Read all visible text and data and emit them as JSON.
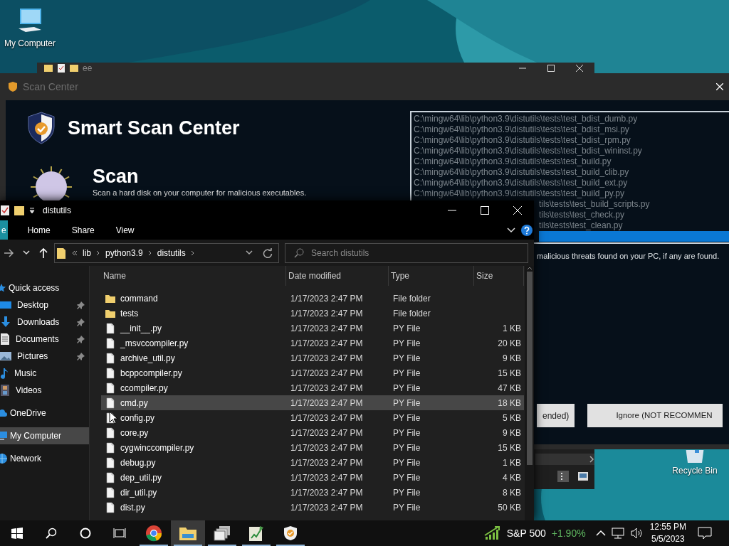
{
  "desktop": {
    "icons": [
      {
        "kind": "computer",
        "label": "My Computer"
      },
      {
        "kind": "recycle",
        "label": "Recycle Bin"
      }
    ]
  },
  "back_window": {
    "title": "ee"
  },
  "scan_window": {
    "title": "Scan Center",
    "heading": "Smart Scan Center",
    "section": {
      "title": "Scan",
      "text": "Scan a hard disk on your computer for malicious executables."
    },
    "results": [
      {
        "path": "C:\\mingw64\\lib\\python3.9\\distutils\\tests\\test_bdist_dumb.py",
        "cut": false,
        "selected": false
      },
      {
        "path": "C:\\mingw64\\lib\\python3.9\\distutils\\tests\\test_bdist_msi.py",
        "cut": false,
        "selected": false
      },
      {
        "path": "C:\\mingw64\\lib\\python3.9\\distutils\\tests\\test_bdist_rpm.py",
        "cut": false,
        "selected": false
      },
      {
        "path": "C:\\mingw64\\lib\\python3.9\\distutils\\tests\\test_bdist_wininst.py",
        "cut": false,
        "selected": false
      },
      {
        "path": "C:\\mingw64\\lib\\python3.9\\distutils\\tests\\test_build.py",
        "cut": false,
        "selected": false
      },
      {
        "path": "C:\\mingw64\\lib\\python3.9\\distutils\\tests\\test_build_clib.py",
        "cut": false,
        "selected": false
      },
      {
        "path": "C:\\mingw64\\lib\\python3.9\\distutils\\tests\\test_build_ext.py",
        "cut": false,
        "selected": false
      },
      {
        "path": "C:\\mingw64\\lib\\python3.9\\distutils\\tests\\test_build_py.py",
        "cut": false,
        "selected": false
      },
      {
        "path": "tils\\tests\\test_build_scripts.py",
        "cut": true,
        "selected": false
      },
      {
        "path": "tils\\tests\\test_check.py",
        "cut": true,
        "selected": false
      },
      {
        "path": "tils\\tests\\test_clean.py",
        "cut": true,
        "selected": false
      },
      {
        "cut": true,
        "selected": true
      }
    ],
    "note": "malicious threats found on your PC, if any are found.",
    "buttons": [
      "ended)",
      "Ignore (NOT RECOMMEN"
    ]
  },
  "explorer": {
    "title": "distutils",
    "ribbon_tabs": [
      {
        "label": "e",
        "kind": "file"
      },
      {
        "label": "Home",
        "kind": "tab"
      },
      {
        "label": "Share",
        "kind": "tab"
      },
      {
        "label": "View",
        "kind": "tab"
      }
    ],
    "path": [
      "lib",
      "python3.9",
      "distutils"
    ],
    "search": {
      "placeholder": "Search distutils"
    },
    "nav": [
      {
        "label": "Quick access",
        "kind": "star",
        "selected": false,
        "children": [
          {
            "label": "Desktop",
            "kind": "desktop",
            "pinned": true,
            "selected": false
          },
          {
            "label": "Downloads",
            "kind": "download",
            "pinned": true,
            "selected": false
          },
          {
            "label": "Documents",
            "kind": "document",
            "pinned": true,
            "selected": false
          },
          {
            "label": "Pictures",
            "kind": "pictures",
            "pinned": true,
            "selected": false
          },
          {
            "label": "Music",
            "kind": "music",
            "pinned": false,
            "selected": false
          },
          {
            "label": "Videos",
            "kind": "video",
            "pinned": false,
            "selected": false
          }
        ]
      },
      {
        "label": "OneDrive",
        "kind": "cloud",
        "selected": false
      },
      {
        "label": "My Computer",
        "kind": "computer",
        "selected": true
      },
      {
        "label": "Network",
        "kind": "network",
        "selected": false
      }
    ],
    "columns": [
      "Name",
      "Date modified",
      "Type",
      "Size"
    ],
    "rows": [
      {
        "kind": "folder",
        "name": "command",
        "date": "1/17/2023 2:47 PM",
        "type": "File folder",
        "size": "",
        "selected": false
      },
      {
        "kind": "folder",
        "name": "tests",
        "date": "1/17/2023 2:47 PM",
        "type": "File folder",
        "size": "",
        "selected": false
      },
      {
        "kind": "file",
        "name": "__init__.py",
        "date": "1/17/2023 2:47 PM",
        "type": "PY File",
        "size": "1 KB",
        "selected": false
      },
      {
        "kind": "file",
        "name": "_msvccompiler.py",
        "date": "1/17/2023 2:47 PM",
        "type": "PY File",
        "size": "20 KB",
        "selected": false
      },
      {
        "kind": "file",
        "name": "archive_util.py",
        "date": "1/17/2023 2:47 PM",
        "type": "PY File",
        "size": "9 KB",
        "selected": false
      },
      {
        "kind": "file",
        "name": "bcppcompiler.py",
        "date": "1/17/2023 2:47 PM",
        "type": "PY File",
        "size": "15 KB",
        "selected": false
      },
      {
        "kind": "file",
        "name": "ccompiler.py",
        "date": "1/17/2023 2:47 PM",
        "type": "PY File",
        "size": "47 KB",
        "selected": false
      },
      {
        "kind": "file",
        "name": "cmd.py",
        "date": "1/17/2023 2:47 PM",
        "type": "PY File",
        "size": "18 KB",
        "selected": true
      },
      {
        "kind": "file",
        "name": "config.py",
        "date": "1/17/2023 2:47 PM",
        "type": "PY File",
        "size": "5 KB",
        "selected": false
      },
      {
        "kind": "file",
        "name": "core.py",
        "date": "1/17/2023 2:47 PM",
        "type": "PY File",
        "size": "9 KB",
        "selected": false
      },
      {
        "kind": "file",
        "name": "cygwinccompiler.py",
        "date": "1/17/2023 2:47 PM",
        "type": "PY File",
        "size": "15 KB",
        "selected": false
      },
      {
        "kind": "file",
        "name": "debug.py",
        "date": "1/17/2023 2:47 PM",
        "type": "PY File",
        "size": "1 KB",
        "selected": false
      },
      {
        "kind": "file",
        "name": "dep_util.py",
        "date": "1/17/2023 2:47 PM",
        "type": "PY File",
        "size": "4 KB",
        "selected": false
      },
      {
        "kind": "file",
        "name": "dir_util.py",
        "date": "1/17/2023 2:47 PM",
        "type": "PY File",
        "size": "8 KB",
        "selected": false
      },
      {
        "kind": "file",
        "name": "dist.py",
        "date": "1/17/2023 2:47 PM",
        "type": "PY File",
        "size": "50 KB",
        "selected": false
      }
    ]
  },
  "taskbar": {
    "apps": [
      {
        "kind": "start",
        "running": false,
        "active": false
      },
      {
        "kind": "search",
        "running": false,
        "active": false
      },
      {
        "kind": "cortana",
        "running": false,
        "active": false
      },
      {
        "kind": "taskview",
        "running": false,
        "active": false
      },
      {
        "kind": "chrome",
        "running": true,
        "active": false
      },
      {
        "kind": "folder",
        "running": true,
        "active": true
      },
      {
        "kind": "windows",
        "running": true,
        "active": false
      },
      {
        "kind": "chartdoc",
        "running": true,
        "active": false
      },
      {
        "kind": "shield",
        "running": true,
        "active": false
      }
    ],
    "stock": {
      "name": "S&P 500",
      "change": "+1.90%"
    },
    "time": "12:55 PM",
    "date": "5/5/2023"
  }
}
